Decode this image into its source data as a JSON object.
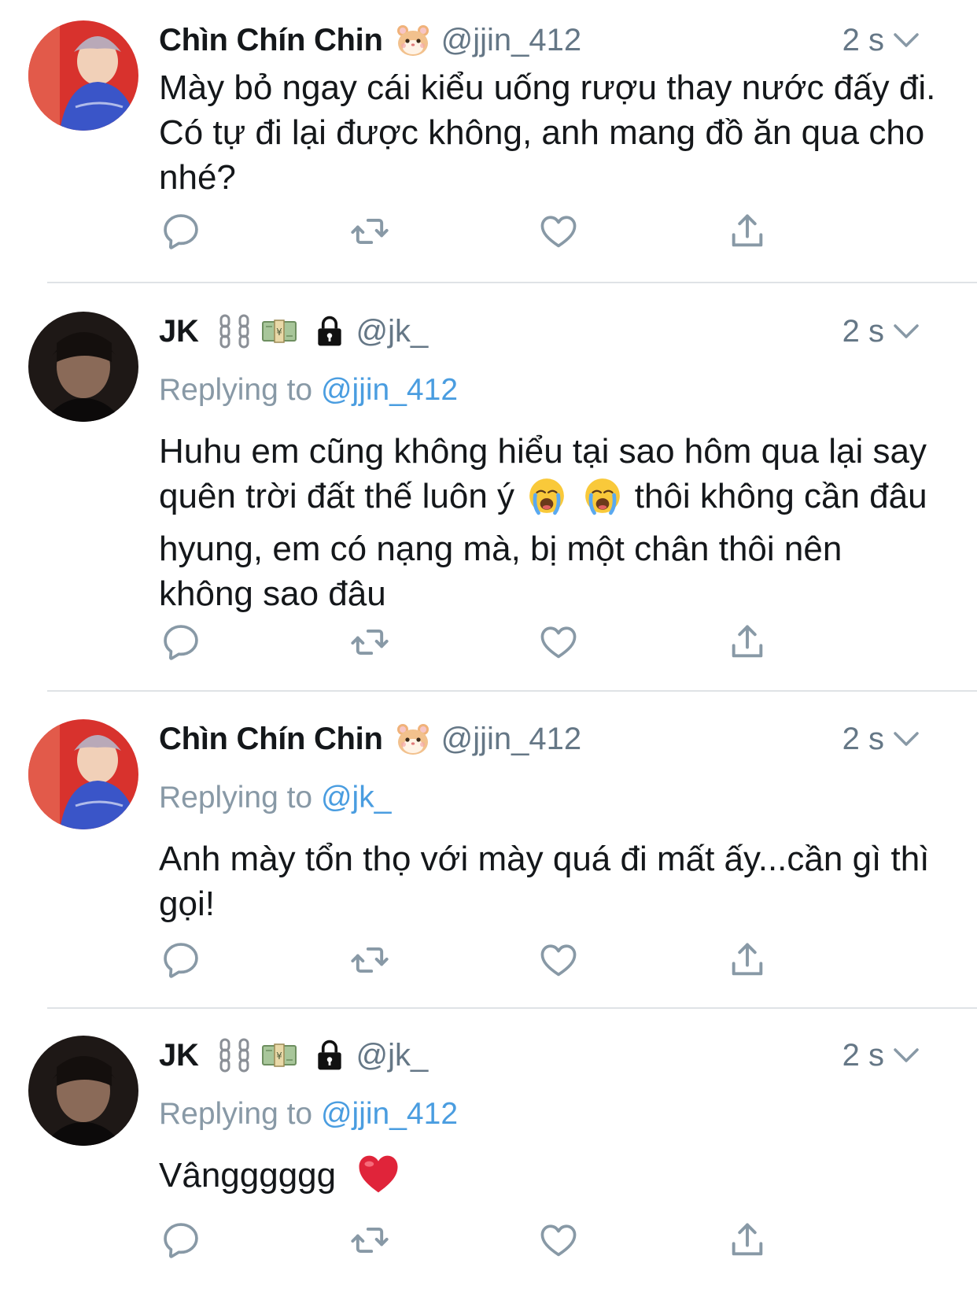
{
  "colors": {
    "text": "#14171a",
    "secondary": "#657786",
    "mention": "#4a9de0",
    "divider": "#dfe3e6",
    "icon": "#8899a6"
  },
  "tweets": [
    {
      "name": "Chìn Chín Chin",
      "name_emoji": [
        "hamster-face-icon"
      ],
      "handle": "@jjin_412",
      "time": "2 s",
      "replying_prefix": "",
      "replying_to": "",
      "text": "Mày bỏ ngay cái kiểu uống rượu thay nước đấy đi. Có tự đi lại được không, anh mang đồ ăn qua cho nhé?"
    },
    {
      "name": "JK",
      "name_emoji": [
        "chains-icon",
        "money-bag-icon",
        "lock-icon"
      ],
      "handle": "@jk_",
      "time": "2 s",
      "replying_prefix": "Replying to",
      "replying_to": "@jjin_412",
      "text_part1": "Huhu em cũng không hiểu tại sao hôm qua lại say quên trời đất thế luôn ý",
      "text_emoji": [
        "crying-face-icon",
        "crying-face-icon"
      ],
      "text_part2": " thôi không cần đâu hyung, em có nạng mà, bị một chân thôi nên không sao đâu"
    },
    {
      "name": "Chìn Chín Chin",
      "name_emoji": [
        "hamster-face-icon"
      ],
      "handle": "@jjin_412",
      "time": "2 s",
      "replying_prefix": "Replying to",
      "replying_to": "@jk_",
      "text": "Anh mày tổn thọ với mày quá đi mất ấy...cần gì thì gọi!"
    },
    {
      "name": "JK",
      "name_emoji": [
        "chains-icon",
        "money-bag-icon",
        "lock-icon"
      ],
      "handle": "@jk_",
      "time": "2 s",
      "replying_prefix": "Replying to",
      "replying_to": "@jjin_412",
      "text": "Vângggggg",
      "text_emoji": [
        "red-heart-icon"
      ]
    }
  ],
  "actions": [
    "reply-icon",
    "retweet-icon",
    "like-icon",
    "share-icon"
  ]
}
